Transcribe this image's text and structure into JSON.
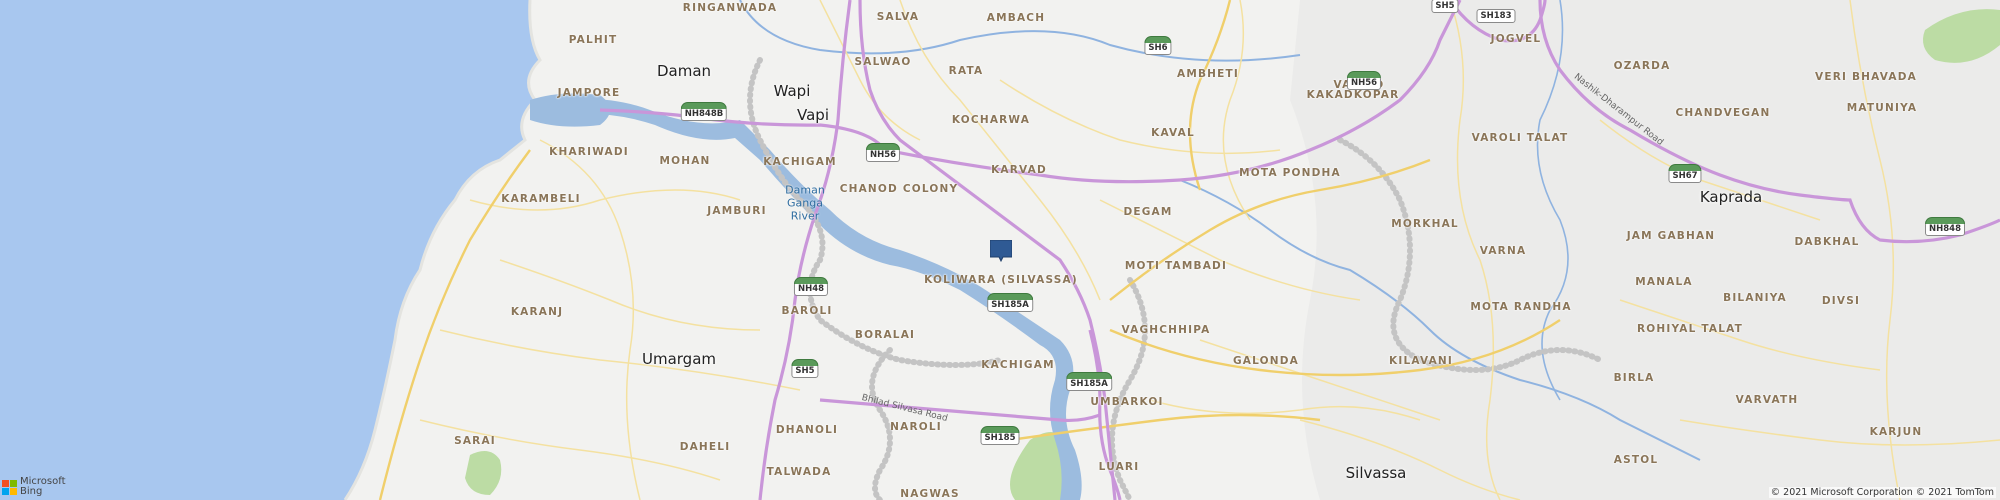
{
  "map": {
    "colors": {
      "sea": "#a8c7ef",
      "land": "#f2f2f0",
      "land_alt": "#e7e7e5",
      "forest": "#b8d8a0",
      "river": "#9cbcdf",
      "river_line": "#7fa7d6",
      "highway": "#c89ad6",
      "major_road": "#f2d98a",
      "boundary": "#c9c9c9",
      "pin": "#2f5a94"
    },
    "towns": [
      {
        "id": "daman",
        "name": "Daman"
      },
      {
        "id": "wapi",
        "name": "Wapi"
      },
      {
        "id": "vapi",
        "name": "Vapi"
      },
      {
        "id": "umargam",
        "name": "Umargam"
      },
      {
        "id": "kaprada",
        "name": "Kaprada"
      },
      {
        "id": "silvassa",
        "name": "Silvassa"
      }
    ],
    "localities": [
      {
        "id": "ringanwada",
        "name": "RINGANWADA"
      },
      {
        "id": "salva",
        "name": "SALVA"
      },
      {
        "id": "ambach",
        "name": "AMBACH"
      },
      {
        "id": "jogvel",
        "name": "JOGVEL"
      },
      {
        "id": "palhit",
        "name": "PALHIT"
      },
      {
        "id": "salwao",
        "name": "SALWAO"
      },
      {
        "id": "vajvad",
        "name": "VAJVAD"
      },
      {
        "id": "ozarda",
        "name": "OZARDA"
      },
      {
        "id": "veri-bhavada",
        "name": "VERI BHAVADA"
      },
      {
        "id": "jampore",
        "name": "JAMPORE"
      },
      {
        "id": "rata",
        "name": "RATA"
      },
      {
        "id": "ambheti",
        "name": "AMBHETI"
      },
      {
        "id": "kakadkopar",
        "name": "KAKADKOPAR"
      },
      {
        "id": "matuniya",
        "name": "MATUNIYA"
      },
      {
        "id": "kocharwa",
        "name": "KOCHARWA"
      },
      {
        "id": "chandvegan",
        "name": "CHANDVEGAN"
      },
      {
        "id": "kaval",
        "name": "KAVAL"
      },
      {
        "id": "varoli-talat",
        "name": "VAROLI TALAT"
      },
      {
        "id": "khariwadi",
        "name": "KHARIWADI"
      },
      {
        "id": "mohan",
        "name": "MOHAN"
      },
      {
        "id": "kachigam-n",
        "name": "KACHIGAM"
      },
      {
        "id": "karvad",
        "name": "KARVAD"
      },
      {
        "id": "mota-pondha",
        "name": "MOTA PONDHA"
      },
      {
        "id": "karambeli",
        "name": "KARAMBELI"
      },
      {
        "id": "chanod-colony",
        "name": "CHANOD COLONY"
      },
      {
        "id": "jamburi",
        "name": "JAMBURI"
      },
      {
        "id": "degam",
        "name": "DEGAM"
      },
      {
        "id": "morkhal",
        "name": "MORKHAL"
      },
      {
        "id": "jam-gabhan",
        "name": "JAM GABHAN"
      },
      {
        "id": "dabkhal",
        "name": "DABKHAL"
      },
      {
        "id": "varna",
        "name": "VARNA"
      },
      {
        "id": "koliwara",
        "name": "KOLIWARA (SILVASSA)"
      },
      {
        "id": "moti-tambadi",
        "name": "MOTI TAMBADI"
      },
      {
        "id": "manala",
        "name": "MANALA"
      },
      {
        "id": "bilaniya",
        "name": "BILANIYA"
      },
      {
        "id": "divsi",
        "name": "DIVSI"
      },
      {
        "id": "karanj",
        "name": "KARANJ"
      },
      {
        "id": "baroli",
        "name": "BAROLI"
      },
      {
        "id": "mota-randha",
        "name": "MOTA RANDHA"
      },
      {
        "id": "vaghchhipa",
        "name": "VAGHCHHIPA"
      },
      {
        "id": "boralai",
        "name": "BORALAI"
      },
      {
        "id": "rohiyal-talat",
        "name": "ROHIYAL TALAT"
      },
      {
        "id": "galonda",
        "name": "GALONDA"
      },
      {
        "id": "kilavani",
        "name": "KILAVANI"
      },
      {
        "id": "kachigam-s",
        "name": "KACHIGAM"
      },
      {
        "id": "birla",
        "name": "BIRLA"
      },
      {
        "id": "umbarkoi",
        "name": "UMBARKOI"
      },
      {
        "id": "varvath",
        "name": "VARVATH"
      },
      {
        "id": "sarai",
        "name": "SARAI"
      },
      {
        "id": "dhanoli",
        "name": "DHANOLI"
      },
      {
        "id": "naroli",
        "name": "NAROLI"
      },
      {
        "id": "karjun",
        "name": "KARJUN"
      },
      {
        "id": "daheli",
        "name": "DAHELI"
      },
      {
        "id": "astol",
        "name": "ASTOL"
      },
      {
        "id": "luari",
        "name": "LUARI"
      },
      {
        "id": "talwada",
        "name": "TALWADA"
      },
      {
        "id": "nagwas",
        "name": "NAGWAS"
      }
    ],
    "water_labels": [
      {
        "id": "daman-ganga-river",
        "lines": [
          "Daman",
          "Ganga",
          "River"
        ]
      }
    ],
    "road_names": [
      {
        "id": "nasik-dharampur-road",
        "name": "Nashik-Dharampur Road"
      },
      {
        "id": "bhilad-silvasa-road",
        "name": "Bhilad Silvasa Road"
      }
    ],
    "shields": [
      {
        "id": "sh5-top",
        "text": "SH5",
        "kind": "state"
      },
      {
        "id": "sh183",
        "text": "SH183",
        "kind": "state"
      },
      {
        "id": "sh6",
        "text": "SH6",
        "kind": "national"
      },
      {
        "id": "nh56-kakadkopar",
        "text": "NH56",
        "kind": "national"
      },
      {
        "id": "nh848b",
        "text": "NH848B",
        "kind": "national"
      },
      {
        "id": "nh56-vapi",
        "text": "NH56",
        "kind": "national"
      },
      {
        "id": "sh67",
        "text": "SH67",
        "kind": "national"
      },
      {
        "id": "nh848",
        "text": "NH848",
        "kind": "national"
      },
      {
        "id": "nh48",
        "text": "NH48",
        "kind": "national"
      },
      {
        "id": "sh185a-1",
        "text": "SH185A",
        "kind": "national"
      },
      {
        "id": "sh5-bottom",
        "text": "SH5",
        "kind": "national"
      },
      {
        "id": "sh185a-2",
        "text": "SH185A",
        "kind": "national"
      },
      {
        "id": "sh185",
        "text": "SH185",
        "kind": "national"
      }
    ],
    "pin": {
      "label": "location-pin"
    },
    "logo": {
      "line1": "Microsoft",
      "line2": "Bing",
      "tiles": [
        "#f25022",
        "#7fba00",
        "#00a4ef",
        "#ffb900"
      ]
    },
    "copyright": "© 2021 Microsoft Corporation © 2021 TomTom"
  }
}
